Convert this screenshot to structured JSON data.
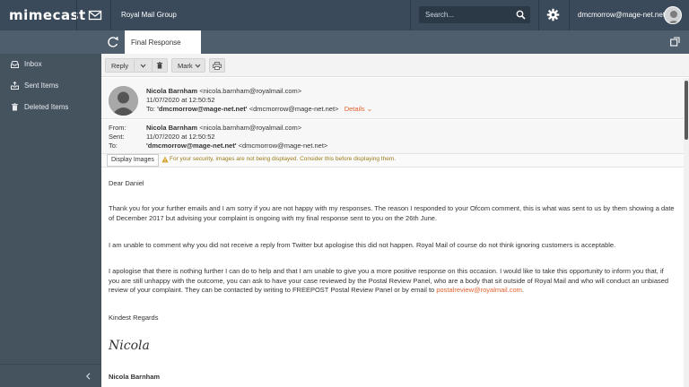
{
  "app": {
    "logo": "mimecast",
    "org_name": "Royal Mail Group"
  },
  "search": {
    "placeholder": "Search..."
  },
  "user": {
    "email": "dmcmorrow@mage-net.net"
  },
  "tabs": {
    "active_label": "Final Response"
  },
  "sidebar": {
    "items": [
      {
        "label": "Inbox",
        "icon": "inbox-icon"
      },
      {
        "label": "Sent Items",
        "icon": "sent-icon"
      },
      {
        "label": "Deleted Items",
        "icon": "trash-icon"
      }
    ]
  },
  "toolbar": {
    "reply_label": "Reply",
    "mark_label": "Mark"
  },
  "email": {
    "sender_line": "Nicola Barnham <nicola.barnham@royalmail.com>",
    "sender_name": "Nicola Barnham",
    "sender_addr": "<nicola.barnham@royalmail.com>",
    "date": "11/07/2020 at 12:50:52",
    "to_prefix": "To:",
    "to_name": "'dmcmorrow@mage-net.net'",
    "to_addr": "<dmcmorrow@mage-net.net>",
    "details_label": "Details",
    "meta": {
      "from_label": "From:",
      "sent_label": "Sent:",
      "to_label": "To:",
      "from_value": "Nicola Barnham <nicola.barnham@royalmail.com>",
      "sent_value": "11/07/2020 at 12:50:52",
      "to_name": "'dmcmorrow@mage-net.net'",
      "to_addr": "<dmcmorrow@mage-net.net>"
    },
    "display_images_label": "Display Images",
    "security_warning": "For your security, images are not being displayed. Consider this before displaying them.",
    "body": {
      "greeting": "Dear Daniel",
      "p1": "Thank you for your further emails and I am sorry if you are not happy with my responses.  The reason I responded to your Ofcom comment, this is what was sent to us by them showing a date of December 2017 but advising your complaint is ongoing with my final response sent to you on the 26th June.",
      "p2": "I am unable to comment why you did not receive a reply from Twitter but apologise this did not happen.  Royal Mail of course do not think ignoring customers is acceptable.",
      "p3": "I apologise that there is nothing further I can do to help and that I am unable to give you a more positive response on this occasion.  I would like to take this opportunity to inform you that, if you are still unhappy with the outcome, you can ask to have your case reviewed by the Postal Review Panel, who are a body that sit outside of Royal Mail and who will conduct an unbiased review of your complaint.  They can be contacted by writing to FREEPOST Postal Review Panel or by email to",
      "p3_link": "postalreview@royalmail.com",
      "p3_end": ".",
      "closing": "Kindest Regards",
      "signature_script": "Nicola",
      "signature_name": "Nicola Barnham"
    }
  },
  "colors": {
    "topbar": "#3b4a5a",
    "sidebar": "#45535f",
    "accent_link": "#e06030",
    "warning": "#9a7b1a"
  }
}
